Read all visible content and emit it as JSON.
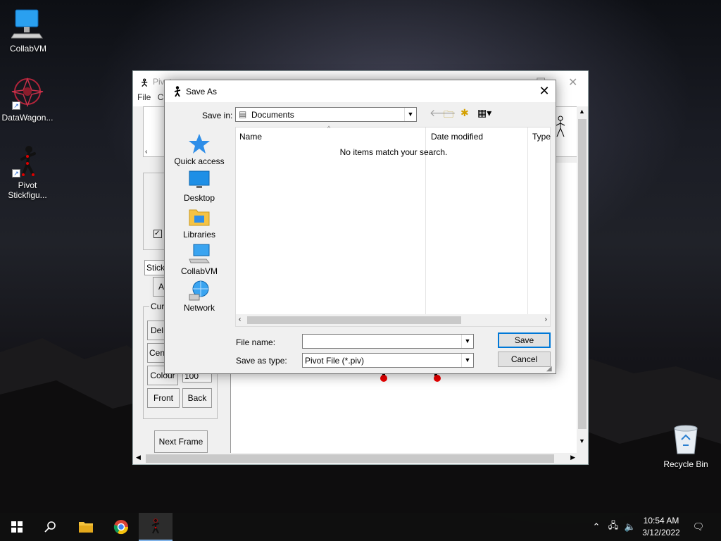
{
  "desktop": {
    "icons": [
      {
        "label": "CollabVM",
        "icon": "monitor-icon"
      },
      {
        "label": "DataWagon...",
        "icon": "datawagon-logo-icon"
      },
      {
        "label": "Pivot Stickfigu...",
        "icon": "stickfigure-icon"
      },
      {
        "label": "Recycle Bin",
        "icon": "recycle-bin-icon"
      }
    ]
  },
  "pivot": {
    "title": "Pivot",
    "menu": [
      "File",
      "C"
    ],
    "buttons": {
      "stick_field": "Stickf",
      "add": "A",
      "current_group": "Curre",
      "delete": "Del",
      "centre": "Cen",
      "colour": "Colour",
      "colour_value": "100",
      "front": "Front",
      "back": "Back",
      "next_frame": "Next Frame"
    }
  },
  "dialog": {
    "title": "Save As",
    "save_in_label": "Save in:",
    "save_in_value": "Documents",
    "places": [
      {
        "label": "Quick access",
        "icon": "star-icon"
      },
      {
        "label": "Desktop",
        "icon": "desktop-icon"
      },
      {
        "label": "Libraries",
        "icon": "libraries-folder-icon"
      },
      {
        "label": "CollabVM",
        "icon": "computer-icon"
      },
      {
        "label": "Network",
        "icon": "network-icon"
      }
    ],
    "columns": [
      "Name",
      "Date modified",
      "Type"
    ],
    "empty_message": "No items match your search.",
    "file_name_label": "File name:",
    "file_name_value": "",
    "save_as_type_label": "Save as type:",
    "save_as_type_value": "Pivot File (*.piv)",
    "save_button": "Save",
    "cancel_button": "Cancel"
  },
  "taskbar": {
    "time": "10:54 AM",
    "date": "3/12/2022",
    "items": [
      "start-icon",
      "search-icon",
      "file-explorer-icon",
      "chrome-icon",
      "pivot-app-icon"
    ]
  }
}
